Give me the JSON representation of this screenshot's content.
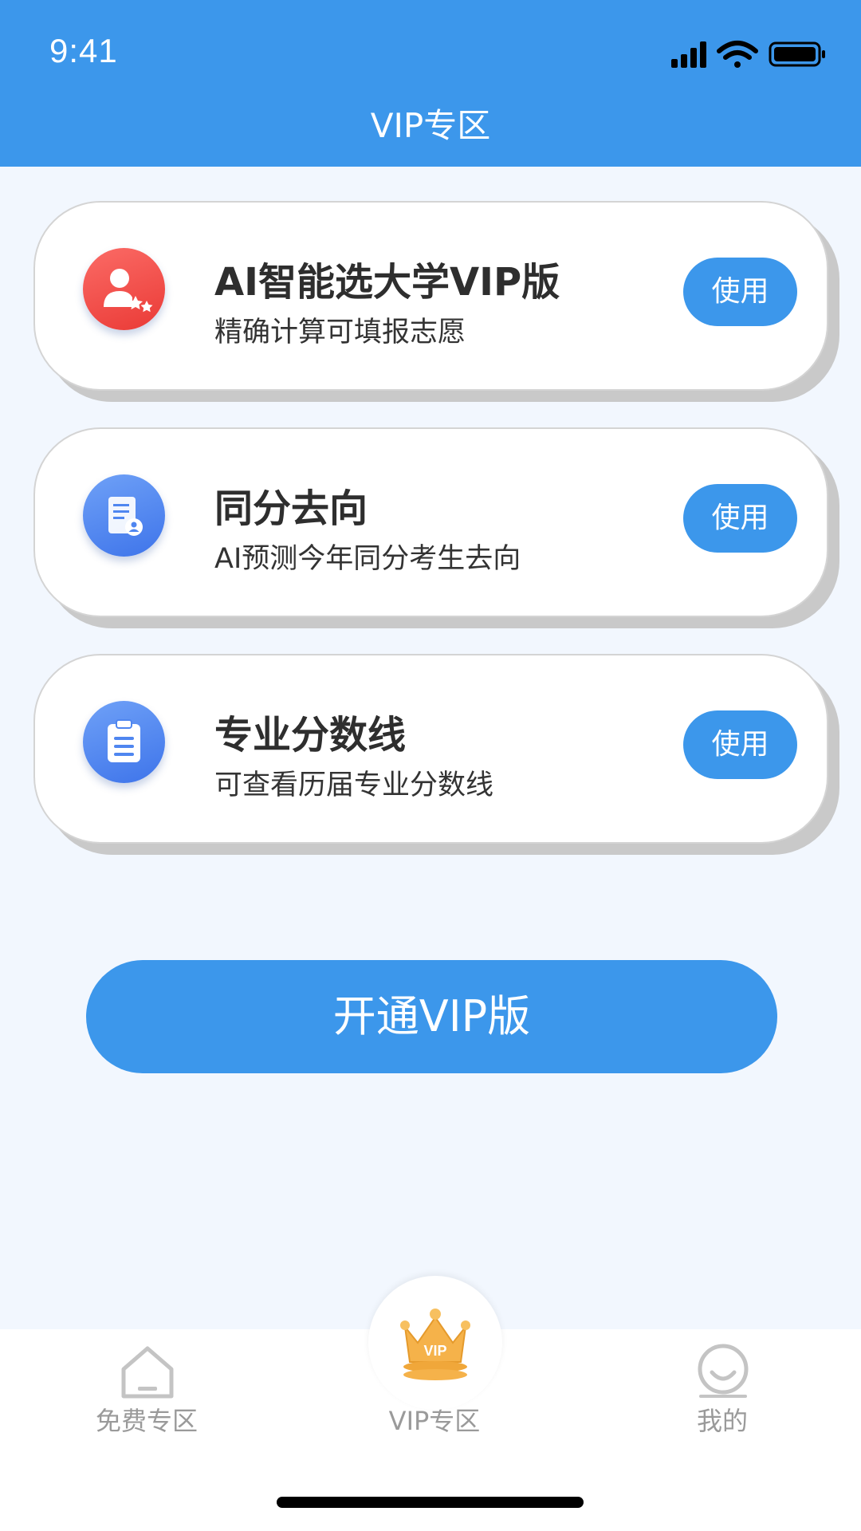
{
  "status_bar": {
    "time": "9:41"
  },
  "header": {
    "title": "VIP专区"
  },
  "cards": [
    {
      "title": "AI智能选大学VIP版",
      "subtitle": "精确计算可填报志愿",
      "button_label": "使用",
      "icon": "user-stars-icon",
      "icon_color": "#f04a45"
    },
    {
      "title": "同分去向",
      "subtitle": "AI预测今年同分考生去向",
      "button_label": "使用",
      "icon": "document-user-icon",
      "icon_color": "#4f86f0"
    },
    {
      "title": "专业分数线",
      "subtitle": "可查看历届专业分数线",
      "button_label": "使用",
      "icon": "clipboard-icon",
      "icon_color": "#4f86f0"
    }
  ],
  "open_vip_button": {
    "label": "开通VIP版"
  },
  "tabbar": {
    "items": [
      {
        "label": "免费专区",
        "icon": "home-icon",
        "active": false
      },
      {
        "label": "VIP专区",
        "icon": "crown-icon",
        "active": true
      },
      {
        "label": "我的",
        "icon": "smile-face-icon",
        "active": false
      }
    ]
  },
  "colors": {
    "primary": "#3c97eb",
    "background": "#f2f7fe",
    "crown": "#f5b24a"
  }
}
